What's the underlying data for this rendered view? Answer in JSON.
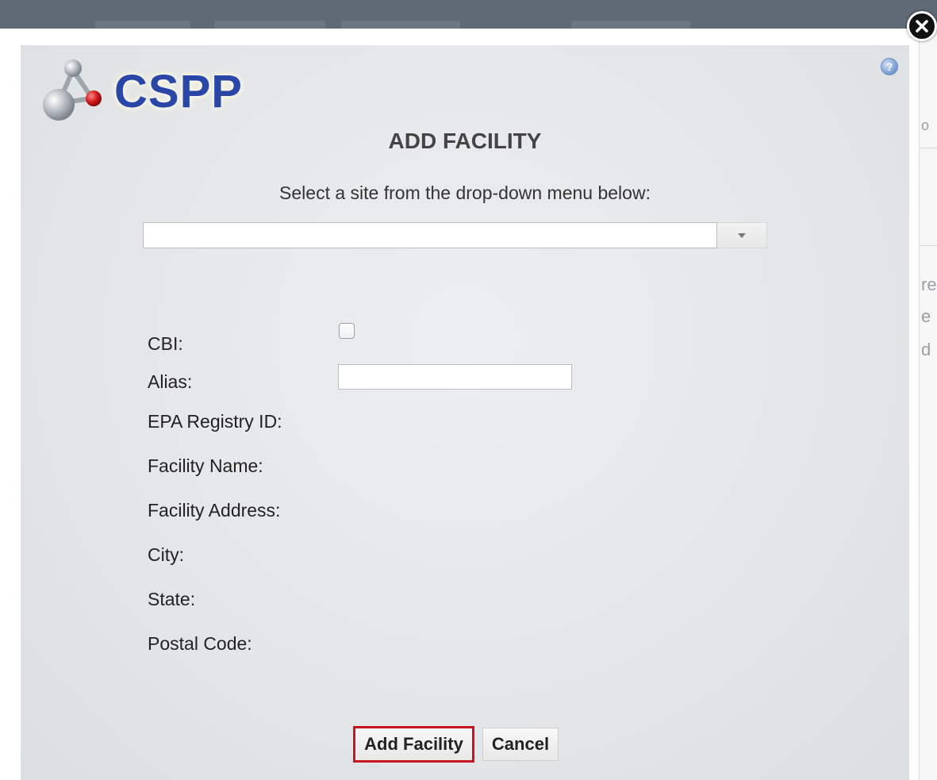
{
  "background": {
    "fragments": [
      "o",
      "re",
      "e",
      "d"
    ]
  },
  "modal": {
    "logo_text": "CSPP",
    "title": "ADD FACILITY",
    "instruction": "Select a site from the drop-down menu below:",
    "site_select": {
      "selected_value": ""
    },
    "fields": {
      "cbi_label": "CBI:",
      "cbi_checked": false,
      "alias_label": "Alias:",
      "alias_value": "",
      "epa_registry_label": "EPA Registry ID:",
      "facility_name_label": "Facility Name:",
      "facility_address_label": "Facility Address:",
      "city_label": "City:",
      "state_label": "State:",
      "postal_code_label": "Postal Code:"
    },
    "buttons": {
      "add_facility": "Add Facility",
      "cancel": "Cancel"
    },
    "help_icon_glyph": "?",
    "close_icon": "close-icon"
  },
  "colors": {
    "accent_border": "#c8161d",
    "logo_blue": "#2a47a8",
    "topbar": "#5f6a75"
  }
}
